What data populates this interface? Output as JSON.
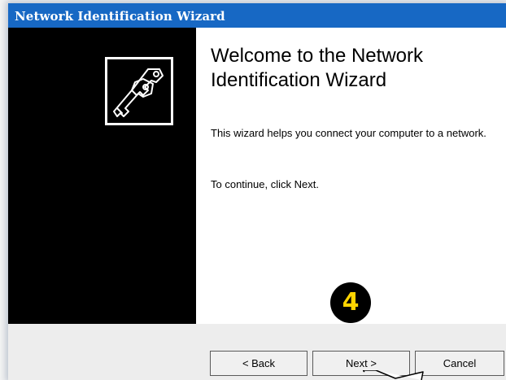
{
  "window": {
    "title": "Network Identification Wizard"
  },
  "wizard": {
    "heading": "Welcome to the Network Identification Wizard",
    "description": "This wizard helps you connect your computer to a network.",
    "instruction": "To continue, click Next.",
    "side_icon": "keys-icon"
  },
  "step_badge": "4",
  "buttons": {
    "back": "< Back",
    "next": "Next >",
    "cancel": "Cancel"
  },
  "colors": {
    "titlebar": "#1768c4",
    "badge_text": "#ffd400",
    "side_panel": "#000000"
  }
}
